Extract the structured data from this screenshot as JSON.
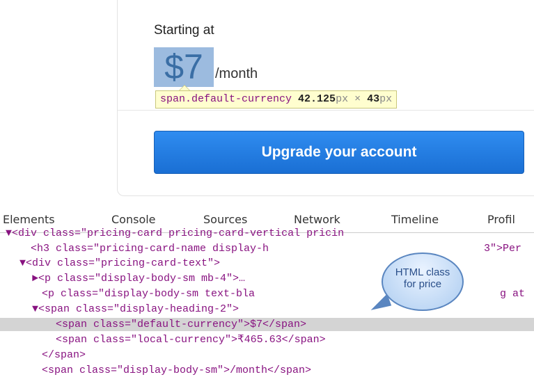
{
  "card": {
    "starting_label": "Starting at",
    "price": "$7",
    "period": "/month",
    "inspect_tooltip": {
      "selector": "span.default-currency",
      "width": "42.125",
      "unit": "px",
      "times": "×",
      "height": "43"
    },
    "upgrade_button": "Upgrade your account"
  },
  "devtools": {
    "tabs": [
      "Elements",
      "Console",
      "Sources",
      "Network",
      "Timeline",
      "Profil"
    ],
    "lines": [
      "▼<div class=\"pricing-card pricing-card-vertical pricin",
      "<h3 class=\"pricing-card-name display-h",
      "3\">Per",
      "▼<div class=\"pricing-card-text\">",
      "►<p class=\"display-body-sm mb-4\">…",
      "<p class=\"display-body-sm text-bla",
      "g at",
      "▼<span class=\"display-heading-2\">",
      "<span class=\"default-currency\">$7</span>",
      "<span class=\"local-currency\">₹465.63</span>",
      "</span>",
      "<span class=\"display-body-sm\">/month</span>"
    ]
  },
  "callout": {
    "line1": "HTML class",
    "line2": "for price"
  }
}
